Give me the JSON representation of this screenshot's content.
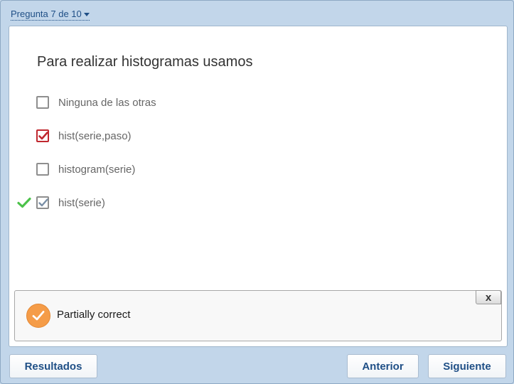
{
  "nav": {
    "label": "Pregunta 7 de 10"
  },
  "question": {
    "text": "Para realizar histogramas usamos",
    "options": [
      {
        "label": "Ninguna de las otras",
        "state": "unchecked"
      },
      {
        "label": "hist(serie,paso)",
        "state": "checked-wrong"
      },
      {
        "label": "histogram(serie)",
        "state": "unchecked"
      },
      {
        "label": "hist(serie)",
        "state": "checked-correct"
      }
    ]
  },
  "feedback": {
    "text": "Partially correct",
    "close_label": "x",
    "icon": "check-circle-icon",
    "icon_color": "#f59c48"
  },
  "buttons": {
    "results": "Resultados",
    "previous": "Anterior",
    "next": "Siguiente"
  },
  "colors": {
    "wrong_check": "#c0282f",
    "correct_mark": "#4cc24a",
    "link": "#1f4f86"
  }
}
